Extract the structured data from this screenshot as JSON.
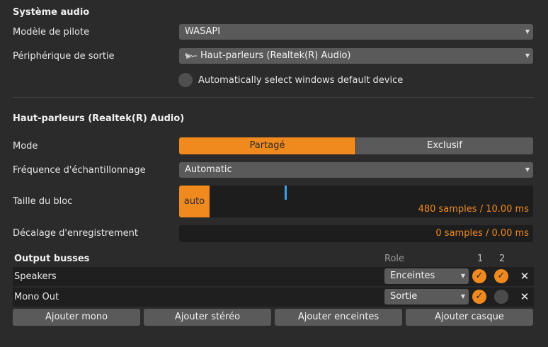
{
  "system_audio": {
    "title": "Système audio",
    "driver_model_label": "Modèle de pilote",
    "driver_model_value": "WASAPI",
    "output_device_label": "Périphérique de sortie",
    "output_device_value": "Haut-parleurs (Realtek(R) Audio)",
    "auto_select_label": "Automatically select windows default device"
  },
  "device": {
    "title": "Haut-parleurs (Realtek(R) Audio)",
    "mode_label": "Mode",
    "mode_options": [
      "Partagé",
      "Exclusif"
    ],
    "mode_selected": "Partagé",
    "sample_rate_label": "Fréquence d'échantillonnage",
    "sample_rate_value": "Automatic",
    "block_size_label": "Taille du bloc",
    "block_size_auto": "auto",
    "block_size_value": "480 samples / 10.00 ms",
    "record_offset_label": "Décalage d'enregistrement",
    "record_offset_value": "0 samples / 0.00 ms"
  },
  "output_busses": {
    "title": "Output busses",
    "role_header": "Role",
    "channel_headers": [
      "1",
      "2"
    ],
    "rows": [
      {
        "name": "Speakers",
        "role": "Enceintes",
        "ch1": true,
        "ch2": true
      },
      {
        "name": "Mono Out",
        "role": "Sortie",
        "ch1": true,
        "ch2": false
      }
    ]
  },
  "buttons": {
    "add_mono": "Ajouter mono",
    "add_stereo": "Ajouter stéréo",
    "add_speakers": "Ajouter enceintes",
    "add_headphones": "Ajouter casque"
  },
  "colors": {
    "accent": "#f08a1f",
    "background": "#2b2b2b",
    "control": "#5a5a5a",
    "field_dark": "#1d1d1d"
  },
  "icons": {
    "caret": "chevron-down-icon",
    "device_icon": "waveform-icon",
    "check": "check-icon",
    "remove": "close-icon"
  }
}
